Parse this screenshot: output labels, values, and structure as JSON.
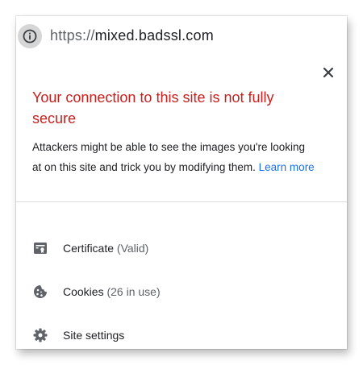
{
  "omnibox": {
    "scheme": "https://",
    "host": "mixed.badssl.com",
    "info_icon": "info-icon"
  },
  "popup": {
    "close_icon": "close-icon",
    "title": "Your connection to this site is not fully secure",
    "description": "Attackers might be able to see the images you're looking at on this site and trick you by modifying them.",
    "learn_more": "Learn more",
    "items": [
      {
        "icon": "certificate-icon",
        "label": "Certificate",
        "detail": "(Valid)"
      },
      {
        "icon": "cookie-icon",
        "label": "Cookies",
        "detail": "(26 in use)"
      },
      {
        "icon": "gear-icon",
        "label": "Site settings",
        "detail": ""
      }
    ]
  },
  "colors": {
    "warning_title": "#c5221f",
    "link": "#1a73e8",
    "text": "#202124",
    "secondary_text": "#5f6368",
    "icon": "#5f6368"
  }
}
